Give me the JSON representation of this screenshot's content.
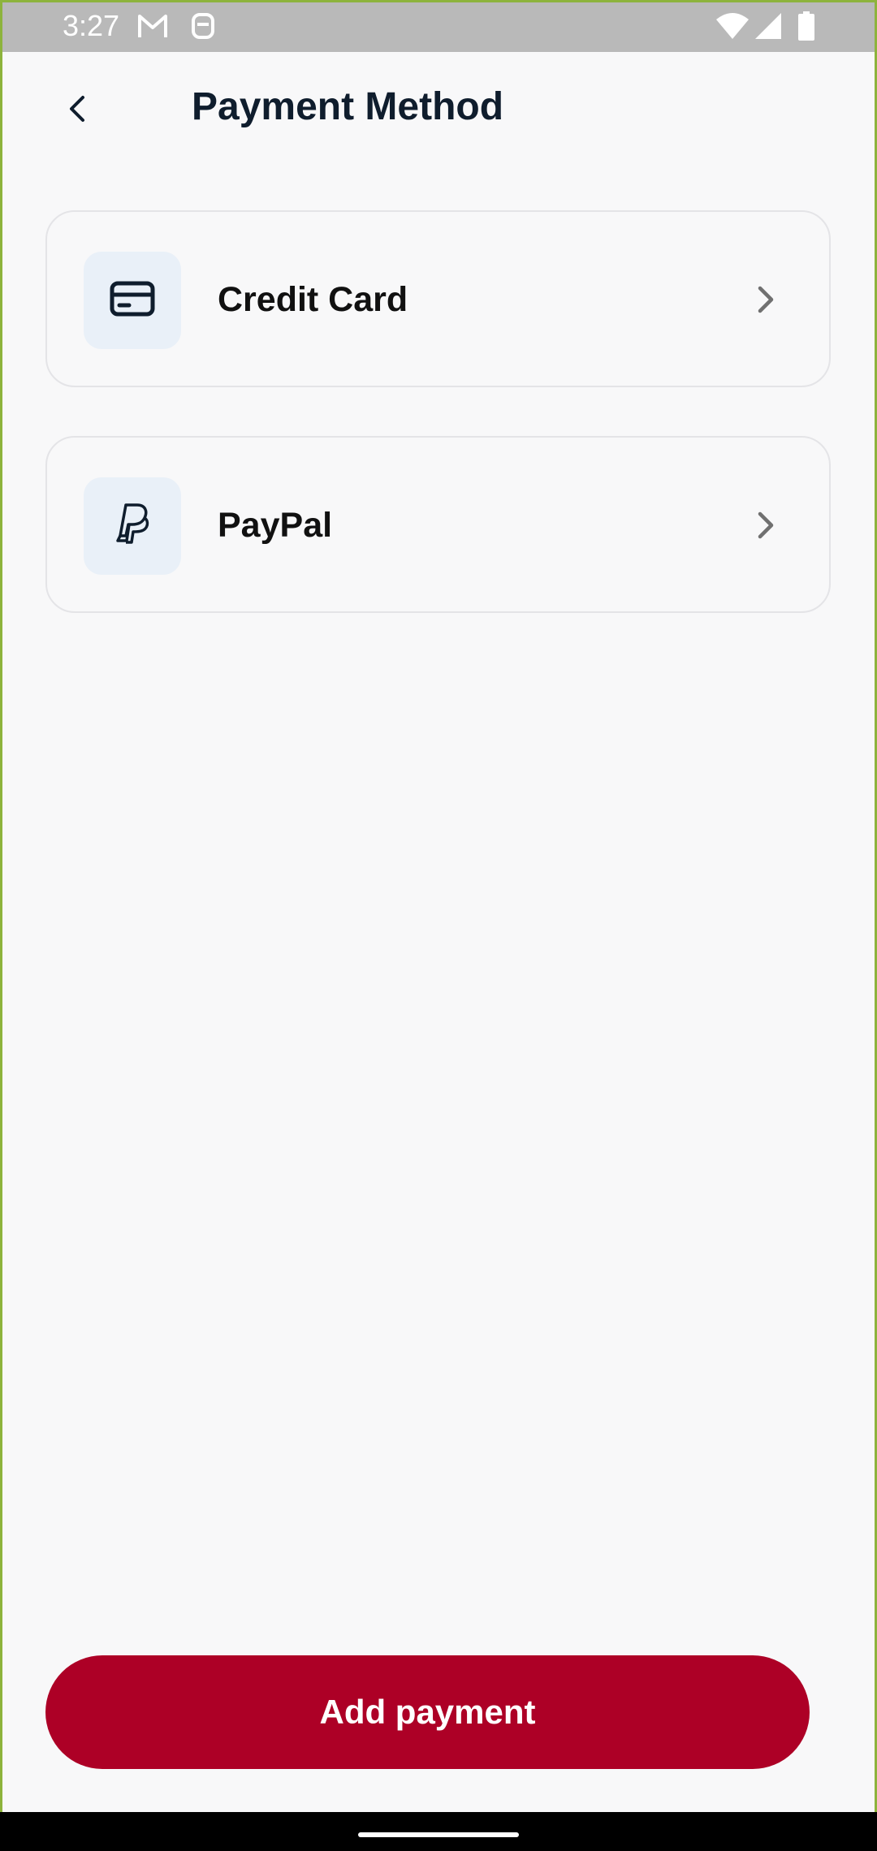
{
  "status_bar": {
    "time": "3:27",
    "icons": [
      "gmail-icon",
      "clipboard-icon",
      "wifi-icon",
      "signal-icon",
      "battery-icon"
    ]
  },
  "header": {
    "title": "Payment Method",
    "back_icon": "chevron-left-icon"
  },
  "payment_methods": [
    {
      "label": "Credit Card",
      "icon": "credit-card-icon"
    },
    {
      "label": "PayPal",
      "icon": "paypal-icon"
    }
  ],
  "actions": {
    "add_payment_label": "Add payment"
  },
  "colors": {
    "primary": "#AD0026",
    "icon_tile": "#E9F0F8",
    "title": "#0F1D2D",
    "background": "#F8F8F9"
  }
}
